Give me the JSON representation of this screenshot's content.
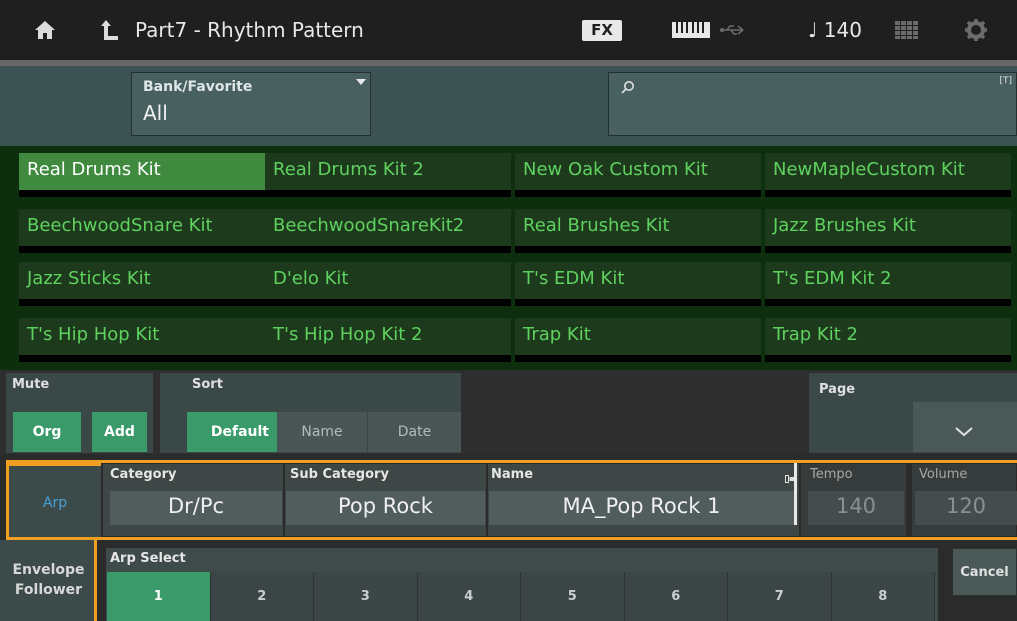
{
  "topbar": {
    "title": "Part7 - Rhythm Pattern",
    "fx_label": "FX",
    "tempo": "♩ 140",
    "icons": [
      "home-icon",
      "back-up-icon",
      "keyboard-icon",
      "usb-icon",
      "grid-icon",
      "gear-icon"
    ]
  },
  "search": {
    "bank_label": "Bank/Favorite",
    "bank_value": "All",
    "search_value": "",
    "text_mode_badge": "[T]"
  },
  "patterns": [
    "Real Drums Kit",
    "Real Drums Kit 2",
    "New Oak Custom Kit",
    "NewMapleCustom Kit",
    "BeechwoodSnare Kit",
    "BeechwoodSnareKit2",
    "Real Brushes Kit",
    "Jazz Brushes Kit",
    "Jazz Sticks Kit",
    "D'elo Kit",
    "T's EDM Kit",
    "T's EDM Kit 2",
    "T's Hip Hop Kit",
    "T's Hip Hop Kit 2",
    "Trap Kit",
    "Trap Kit 2"
  ],
  "selected_pattern": "Real Drums Kit",
  "controls": {
    "mute_label": "Mute",
    "mute_org": "Org",
    "mute_add": "Add",
    "sort_label": "Sort",
    "sort_default": "Default",
    "sort_name": "Name",
    "sort_date": "Date",
    "page_label": "Page"
  },
  "bottom": {
    "arp_tab": "Arp",
    "env_tab_line1": "Envelope",
    "env_tab_line2": "Follower",
    "category_label": "Category",
    "category_value": "Dr/Pc",
    "subcategory_label": "Sub Category",
    "subcategory_value": "Pop Rock",
    "name_label": "Name",
    "name_value": "MA_Pop Rock 1",
    "tempo_label": "Tempo",
    "tempo_value": "140",
    "volume_label": "Volume",
    "volume_value": "120",
    "arp_select_label": "Arp Select",
    "arp_select": [
      "1",
      "2",
      "3",
      "4",
      "5",
      "6",
      "7",
      "8"
    ],
    "arp_selected": "1",
    "cancel_label": "Cancel"
  },
  "colors": {
    "accent_orange": "#f0a020",
    "selected_green": "#3f8a3f",
    "pattern_text_green": "#5fd15f",
    "button_on_green": "#3b9a6a",
    "arp_tab_blue": "#45a0d8"
  }
}
